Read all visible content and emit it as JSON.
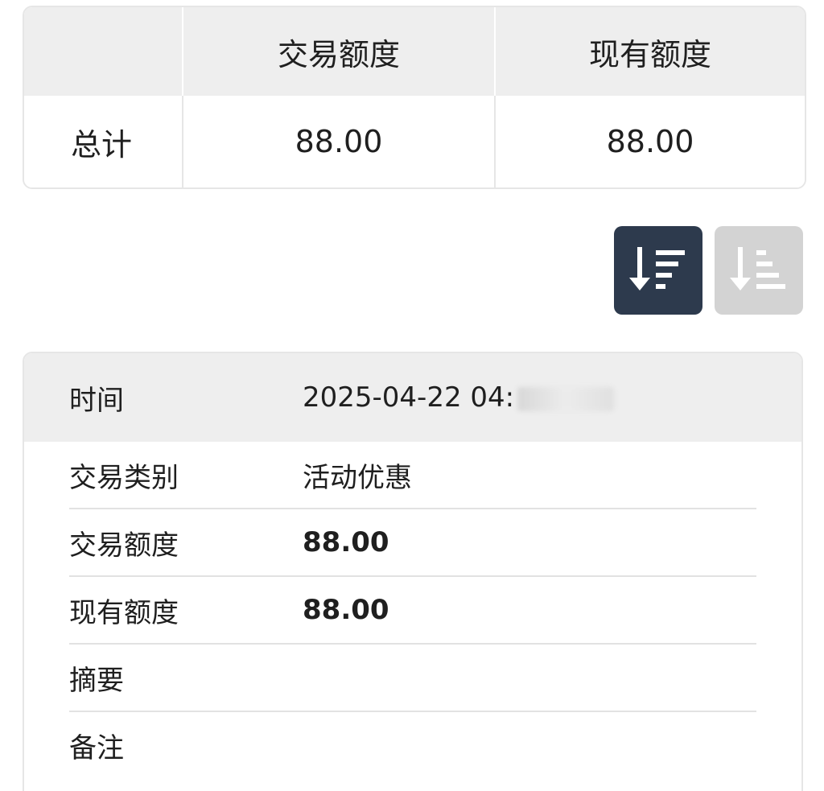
{
  "summary": {
    "headers": [
      "",
      "交易额度",
      "现有额度"
    ],
    "total_label": "总计",
    "total_trade": "88.00",
    "total_current": "88.00"
  },
  "sort": {
    "desc_icon": "sort-descending-icon",
    "asc_icon": "sort-ascending-icon",
    "active_color": "#2d3a4d",
    "inactive_color": "#d3d3d3"
  },
  "record": {
    "time_label": "时间",
    "time_value": "2025-04-22 04:",
    "type_label": "交易类别",
    "type_value": "活动优惠",
    "trade_label": "交易额度",
    "trade_value": "88.00",
    "current_label": "现有额度",
    "current_value": "88.00",
    "summary_label": "摘要",
    "summary_value": "",
    "note_label": "备注",
    "note_value": ""
  }
}
